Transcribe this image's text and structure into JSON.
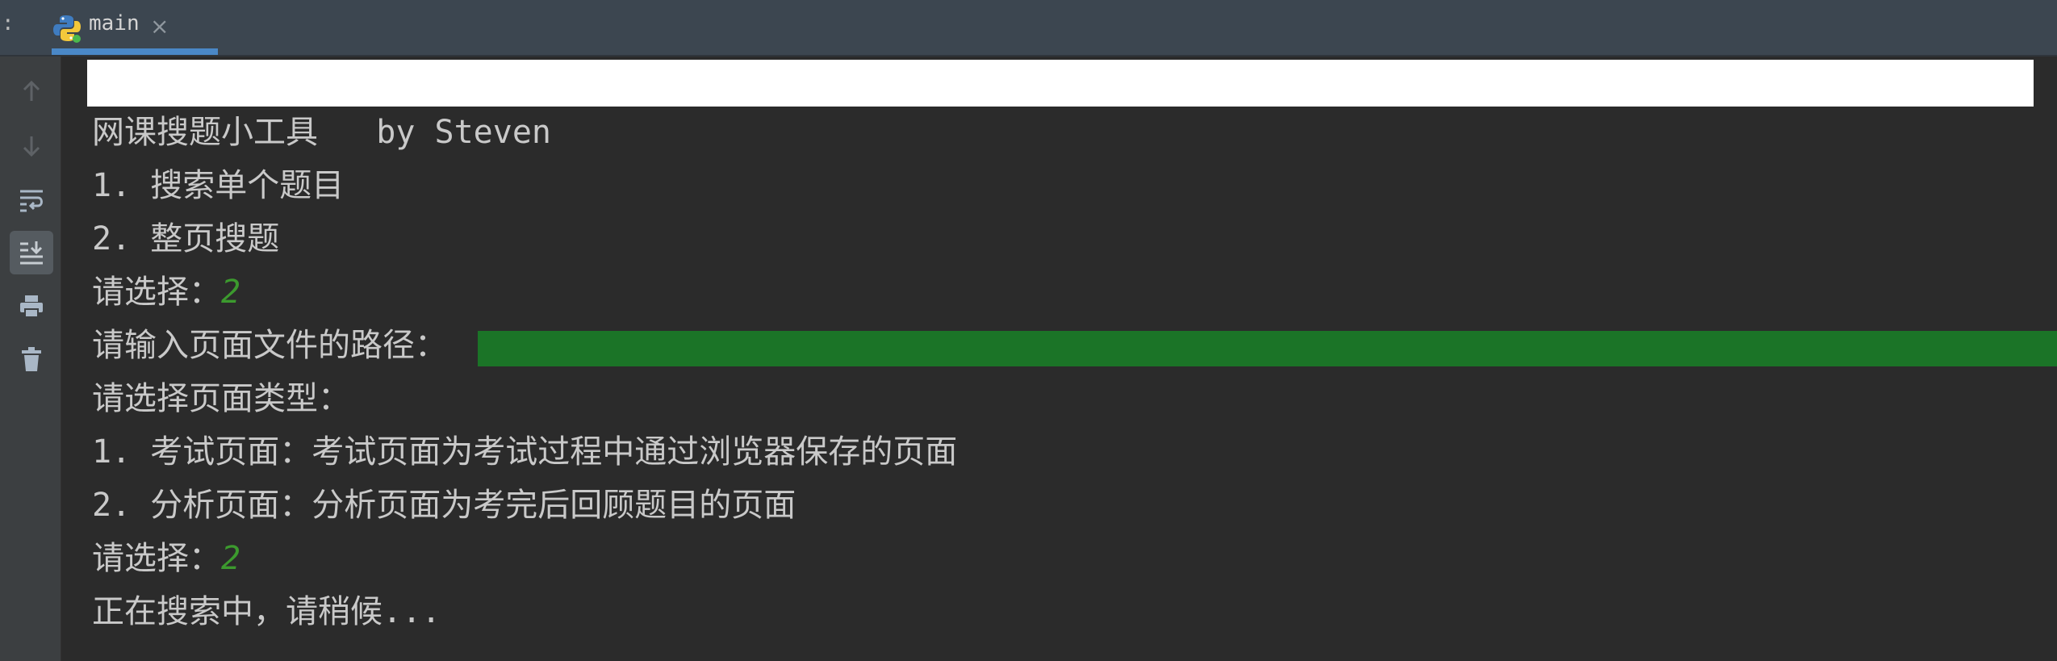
{
  "tabbar": {
    "colon": ":",
    "tab_label": "main",
    "close_glyph": "×"
  },
  "toolbar": {
    "icons": [
      "arrow-up-icon",
      "arrow-down-icon",
      "soft-wrap-icon",
      "scroll-to-end-icon",
      "print-icon",
      "trash-icon"
    ],
    "active": "scroll-to-end-icon"
  },
  "console": {
    "lines": [
      "网课搜题小工具   by Steven",
      "1. 搜索单个题目",
      "2. 整页搜题",
      "请选择：",
      "请输入页面文件的路径：",
      "请选择页面类型：",
      "1. 考试页面：考试页面为考试过程中通过浏览器保存的页面",
      "2. 分析页面：分析页面为考完后回顾题目的页面",
      "请选择：",
      "正在搜索中，请稍候..."
    ],
    "input_1": "2",
    "input_2": "2"
  },
  "colors": {
    "background": "#2b2b2b",
    "text": "#c9c9c9",
    "input": "#3c9a2e",
    "highlight": "#1b7427",
    "tab_accent": "#4a88c7"
  }
}
